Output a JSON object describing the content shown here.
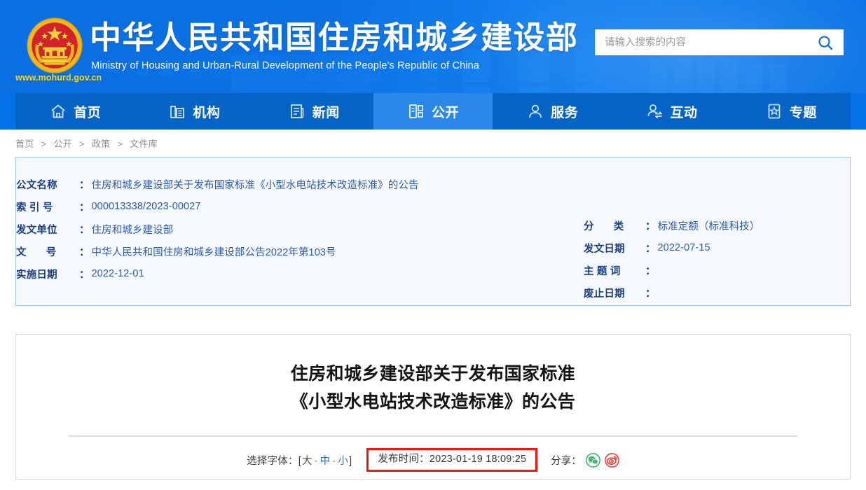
{
  "header": {
    "emblem_name": "national-emblem",
    "site_url": "www.mohurd.gov.cn",
    "title_cn": "中华人民共和国住房和城乡建设部",
    "title_en": "Ministry of Housing and Urban-Rural Development of the People's Republic of China",
    "search": {
      "placeholder": "请输入搜索的内容",
      "value": "",
      "icon": "search-icon"
    }
  },
  "nav": {
    "items": [
      {
        "label": "首页",
        "icon": "home-icon",
        "active": false
      },
      {
        "label": "机构",
        "icon": "building-icon",
        "active": false
      },
      {
        "label": "新闻",
        "icon": "document-icon",
        "active": false
      },
      {
        "label": "公开",
        "icon": "open-folder-icon",
        "active": true
      },
      {
        "label": "服务",
        "icon": "person-icon",
        "active": false
      },
      {
        "label": "互动",
        "icon": "interaction-icon",
        "active": false
      },
      {
        "label": "专题",
        "icon": "star-badge-icon",
        "active": false
      }
    ]
  },
  "breadcrumb": {
    "items": [
      "首页",
      "公开",
      "政策",
      "文件库"
    ],
    "separator": ">"
  },
  "meta": {
    "left": [
      {
        "label": "公文名称",
        "label_pad": false,
        "value": "住房和城乡建设部关于发布国家标准《小型水电站技术改造标准》的公告"
      },
      {
        "label": "索 引 号",
        "label_pad": false,
        "value": "000013338/2023-00027"
      },
      {
        "label": "发文单位",
        "label_pad": false,
        "value": "住房和城乡建设部"
      },
      {
        "label": "文",
        "label_pad": true,
        "label_tail": "号",
        "value": "中华人民共和国住房和城乡建设部公告2022年第103号"
      },
      {
        "label": "实施日期",
        "label_pad": false,
        "value": "2022-12-01"
      }
    ],
    "right": [
      {
        "label": "分",
        "label_pad": true,
        "label_tail": "类",
        "value": "标准定额（标准科技）"
      },
      {
        "label": "发文日期",
        "label_pad": false,
        "value": "2022-07-15"
      },
      {
        "label": "主 题 词",
        "label_pad": false,
        "value": ""
      },
      {
        "label": "废止日期",
        "label_pad": false,
        "value": ""
      }
    ]
  },
  "article": {
    "title_line1": "住房和城乡建设部关于发布国家标准",
    "title_line2": "《小型水电站技术改造标准》的公告",
    "toolbar": {
      "font_select_label": "选择字体：",
      "bracket_open": "[",
      "bracket_close": "]",
      "font_large": "大",
      "font_medium": "中",
      "font_small": "小",
      "dash": "-",
      "publish_label": "发布时间：",
      "publish_time": "2023-01-19 18:09:25",
      "share_label": "分享：",
      "share_icons": [
        "wechat-icon",
        "weibo-icon"
      ]
    }
  },
  "colors": {
    "header_blue": "#0b72e4",
    "nav_blue": "#0664c6",
    "nav_active": "#2b88e9",
    "meta_panel_bg": "#f5f9fe",
    "meta_panel_border": "#9cc3ea",
    "meta_label": "#1b3f80",
    "meta_value": "#2d5aa8",
    "highlight_red": "#f2180f",
    "link_blue": "#2a6fd0",
    "emblem_gold": "#f5c518",
    "emblem_red": "#d3232a",
    "wechat_green": "#2cb15c",
    "weibo_red": "#e6302e"
  }
}
